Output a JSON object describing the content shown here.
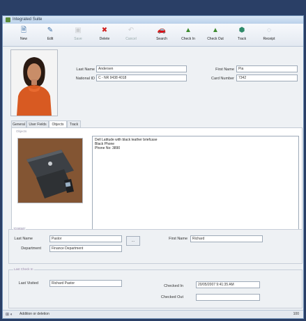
{
  "window": {
    "title": "Integrated Suite"
  },
  "toolbar": {
    "buttons": [
      {
        "label": "New",
        "icon": "new-icon",
        "glyph": "🗎",
        "color": "#3a6ea5",
        "enabled": true
      },
      {
        "label": "Edit",
        "icon": "edit-icon",
        "glyph": "✎",
        "color": "#3a6ea5",
        "enabled": true
      },
      {
        "label": "Save",
        "icon": "save-icon",
        "glyph": "▣",
        "color": "#888888",
        "enabled": false
      },
      {
        "label": "Delete",
        "icon": "delete-icon",
        "glyph": "✖",
        "color": "#d02020",
        "enabled": true
      },
      {
        "label": "Cancel",
        "icon": "cancel-icon",
        "glyph": "↶",
        "color": "#888888",
        "enabled": false
      },
      {
        "label": "Search",
        "icon": "search-icon",
        "glyph": "🚗",
        "color": "#2c3e5a",
        "enabled": true
      },
      {
        "label": "Check In",
        "icon": "check-in-icon",
        "glyph": "▲",
        "color": "#3d8a2e",
        "enabled": true
      },
      {
        "label": "Check Out",
        "icon": "check-out-icon",
        "glyph": "▲",
        "color": "#3d8a2e",
        "enabled": true
      },
      {
        "label": "Track",
        "icon": "track-icon",
        "glyph": "⬢",
        "color": "#2f8a6a",
        "enabled": true
      },
      {
        "label": "Receipt",
        "icon": "receipt-icon",
        "glyph": "◌",
        "color": "#9aa6b2",
        "enabled": true
      }
    ]
  },
  "person": {
    "last_name_label": "Last Name",
    "last_name_value": "Andersen",
    "first_name_label": "First Name",
    "first_name_value": "Pia",
    "national_id_label": "National ID",
    "national_id_value": "C - NR 9438 4018",
    "card_number_label": "Card Number",
    "card_number_value": "7342"
  },
  "tabs": [
    {
      "label": "General"
    },
    {
      "label": "User Fields"
    },
    {
      "label": "Objects"
    },
    {
      "label": "Track"
    }
  ],
  "object": {
    "group_caption": "Objects",
    "description_lines": [
      "Dell Latitude with black leather briefcase",
      "Black Phone",
      "Phone No: 3890"
    ]
  },
  "contact": {
    "group_caption": "Contact",
    "last_name_label": "Last Name",
    "last_name_value": "Pastor",
    "first_name_label": "First Name",
    "first_name_value": "Richard",
    "department_label": "Department",
    "department_value": "Finance Department",
    "browse_label": "..."
  },
  "last_check": {
    "group_caption": "Last Check In",
    "last_visited_label": "Last Visited",
    "last_visited_value": "Richard Pastor",
    "checked_in_label": "Checked In",
    "checked_in_value": "20/05/2007 9:41:35 AM",
    "checked_out_label": "Checked Out",
    "checked_out_value": ""
  },
  "status": {
    "text": "Addition or deletion",
    "right": "100"
  }
}
